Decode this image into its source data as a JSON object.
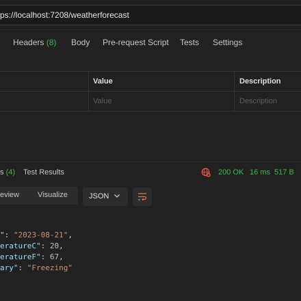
{
  "request": {
    "url": "ps://localhost:7208/weatherforecast"
  },
  "request_tabs": [
    {
      "label": "Headers",
      "count": "(8)"
    },
    {
      "label": "Body",
      "count": ""
    },
    {
      "label": "Pre-request Script",
      "count": ""
    },
    {
      "label": "Tests",
      "count": ""
    },
    {
      "label": "Settings",
      "count": ""
    }
  ],
  "params_table": {
    "headers": [
      "Value",
      "Description"
    ],
    "placeholders": [
      "Value",
      "Description"
    ]
  },
  "response": {
    "tabs": [
      {
        "label": "s",
        "count": "(4)"
      },
      {
        "label": "Test Results",
        "count": ""
      }
    ],
    "status": "200 OK",
    "time": "16 ms",
    "size": "517 B",
    "views": [
      "eview",
      "Visualize"
    ],
    "format": "JSON",
    "body_lines": [
      {
        "key": "\"",
        "value": "\"2023-08-21\"",
        "type": "str",
        "comma": ","
      },
      {
        "key": "eratureC\"",
        "value": "20",
        "type": "num",
        "comma": ","
      },
      {
        "key": "eratureF\"",
        "value": "67",
        "type": "num",
        "comma": ","
      },
      {
        "key": "ary\"",
        "value": "\"Freezing\"",
        "type": "str",
        "comma": ""
      }
    ]
  },
  "colors": {
    "background": "#212121",
    "success": "#3fb950",
    "json_key": "#9cdcfe",
    "json_string": "#ce9178",
    "json_number": "#b5cea8"
  }
}
